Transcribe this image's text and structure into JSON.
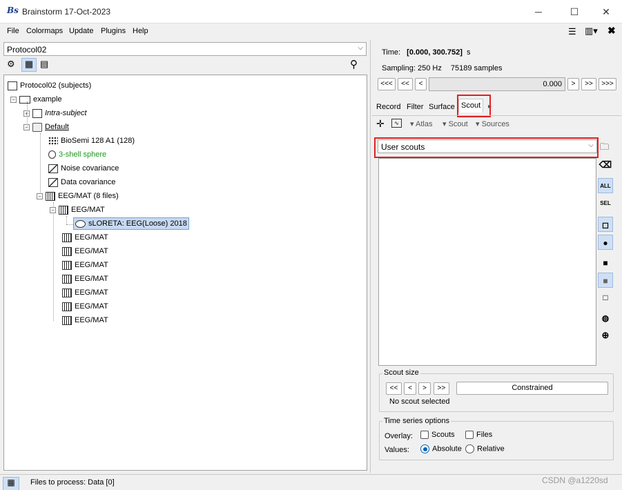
{
  "window": {
    "title": "Brainstorm 17-Oct-2023",
    "app_icon": "Bs"
  },
  "menu": [
    "File",
    "Colormaps",
    "Update",
    "Plugins",
    "Help"
  ],
  "protocol_select": {
    "value": "Protocol02"
  },
  "tree": {
    "root": "Protocol02 (subjects)",
    "subject": "example",
    "intra": "Intra-subject",
    "default": "Default",
    "items": [
      {
        "label": "BioSemi 128 A1 (128)",
        "icon": "channels-icon"
      },
      {
        "label": "3-shell sphere",
        "icon": "head-model-icon",
        "color": "#1a9a1a"
      },
      {
        "label": "Noise covariance",
        "icon": "covariance-icon"
      },
      {
        "label": "Data covariance",
        "icon": "covariance-icon"
      }
    ],
    "eeg_group": "EEG/MAT (8 files)",
    "eeg_first": "EEG/MAT",
    "source": "sLORETA: EEG(Loose) 2018",
    "eeg_rest": [
      "EEG/MAT",
      "EEG/MAT",
      "EEG/MAT",
      "EEG/MAT",
      "EEG/MAT",
      "EEG/MAT",
      "EEG/MAT"
    ]
  },
  "time": {
    "label": "Time:",
    "value": "[0.000, 300.752]",
    "unit": "s",
    "sampling": "Sampling: 250 Hz",
    "samples": "75189 samples",
    "current": "0.000"
  },
  "nav_buttons": [
    "<<<",
    "<<",
    "<",
    ">",
    ">>",
    ">>>"
  ],
  "tabs": [
    "Record",
    "Filter",
    "Surface",
    "Scout"
  ],
  "active_tab": "Scout",
  "scout_toolbar": {
    "atlas": "Atlas",
    "scout": "Scout",
    "sources": "Sources"
  },
  "scout_select": {
    "value": "User scouts"
  },
  "side_buttons": {
    "all": "ALL",
    "sel": "SEL"
  },
  "scout_size": {
    "title": "Scout size",
    "buttons": [
      "<<",
      "<",
      ">",
      ">>"
    ],
    "constrained": "Constrained",
    "status": "No scout selected"
  },
  "time_series": {
    "title": "Time series options",
    "overlay_label": "Overlay:",
    "scouts": "Scouts",
    "files": "Files",
    "values_label": "Values:",
    "absolute": "Absolute",
    "relative": "Relative"
  },
  "bottom": {
    "files_to_process": "Files to process: Data [0]"
  },
  "watermark": "CSDN @a1220sd"
}
